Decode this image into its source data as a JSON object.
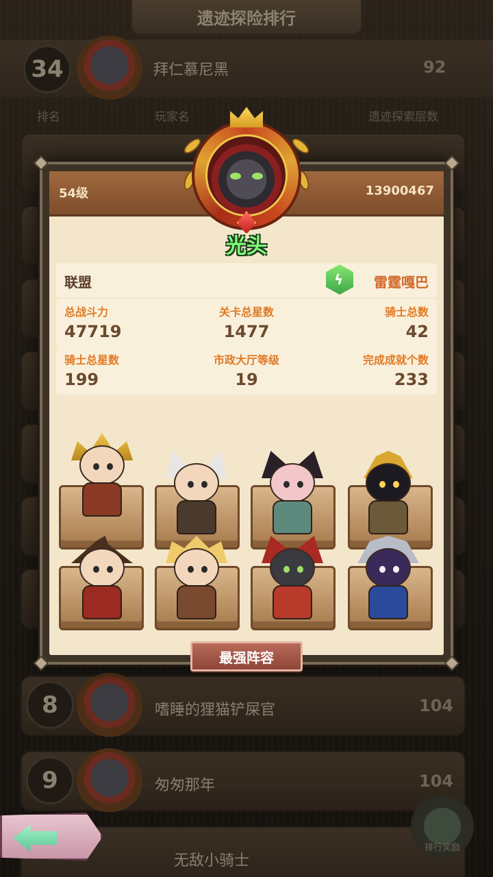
{
  "background": {
    "title": "遗迹探险排行",
    "my_rank": {
      "rank": "34",
      "name": "拜仁慕尼黑",
      "score": "92"
    },
    "headers": {
      "rank": "排名",
      "player": "玩家名",
      "depth": "遗迹探索层数"
    },
    "rows": [
      {
        "rank": "8",
        "name": "嗜睡的狸猫铲屎官",
        "score": "104"
      },
      {
        "rank": "9",
        "name": "匆匆那年",
        "score": "104"
      },
      {
        "rank": "",
        "name": "无敌小骑士",
        "score": ""
      }
    ],
    "reward_label": "排行奖励"
  },
  "popup": {
    "level": "54级",
    "player_id": "13900467",
    "player_name": "光头",
    "alliance": {
      "label": "联盟",
      "name": "雷霆嘎巴",
      "icon": "lightning-icon"
    },
    "stats": [
      {
        "label": "总战斗力",
        "value": "47719"
      },
      {
        "label": "关卡总星数",
        "value": "1477"
      },
      {
        "label": "骑士总数",
        "value": "42"
      },
      {
        "label": "骑士总星数",
        "value": "199"
      },
      {
        "label": "市政大厅等级",
        "value": "19"
      },
      {
        "label": "完成成就个数",
        "value": "233"
      }
    ],
    "team_button": "最强阵容"
  },
  "colors": {
    "name_green": "#7dff7a",
    "stat_label_orange": "#e07a24",
    "alliance_name_orange": "#d16a2c",
    "button_red": "#a65848"
  }
}
